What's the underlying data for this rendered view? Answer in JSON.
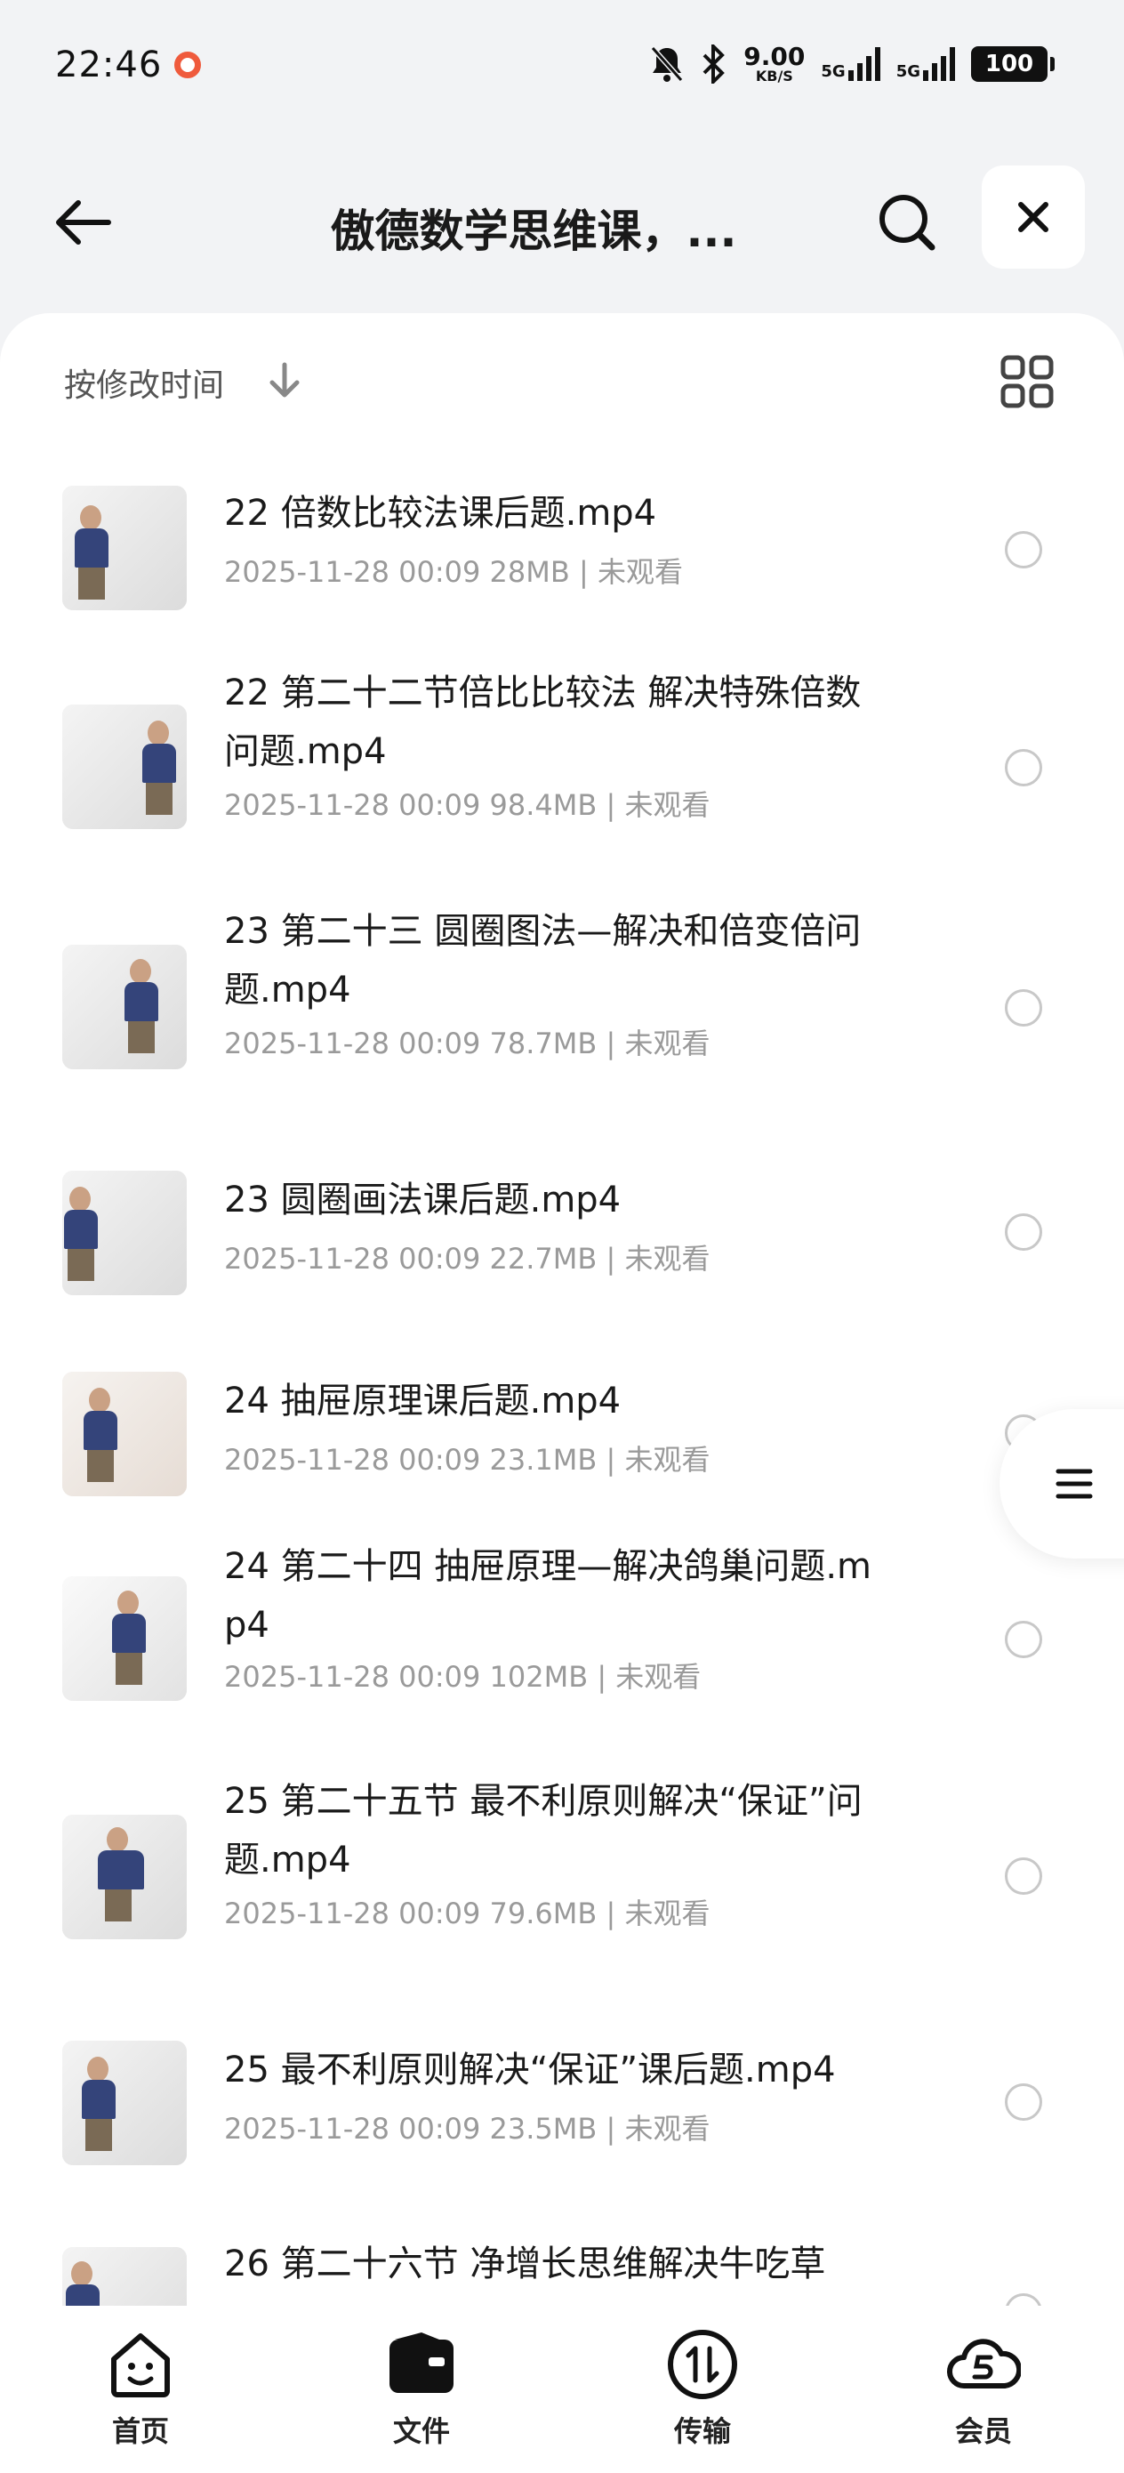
{
  "status_bar": {
    "time": "22:46",
    "net_speed": "9.00",
    "net_unit": "KB/S",
    "signal1_label": "5G",
    "signal2_label": "5G",
    "battery": "100"
  },
  "header": {
    "title": "傲德数学思维课，...",
    "back_icon": "arrow-left-icon",
    "search_icon": "search-icon",
    "close_icon": "close-icon"
  },
  "sort": {
    "label": "按修改时间",
    "direction_icon": "arrow-down-icon",
    "view_icon": "grid-view-icon"
  },
  "files": [
    {
      "name": "22 倍数比较法课后题.mp4",
      "date": "2025-11-28 00:09",
      "size": "28MB",
      "status": "未观看"
    },
    {
      "name": "22 第二十二节倍比比较法 解决特殊倍数问题.mp4",
      "date": "2025-11-28 00:09",
      "size": "98.4MB",
      "status": "未观看"
    },
    {
      "name": "23 第二十三 圆圈图法—解决和倍变倍问题.mp4",
      "date": "2025-11-28 00:09",
      "size": "78.7MB",
      "status": "未观看"
    },
    {
      "name": "23 圆圈画法课后题.mp4",
      "date": "2025-11-28 00:09",
      "size": "22.7MB",
      "status": "未观看"
    },
    {
      "name": "24 抽屉原理课后题.mp4",
      "date": "2025-11-28 00:09",
      "size": "23.1MB",
      "status": "未观看"
    },
    {
      "name": "24 第二十四 抽屉原理—解决鸽巢问题.mp4",
      "date": "2025-11-28 00:09",
      "size": "102MB",
      "status": "未观看"
    },
    {
      "name": "25 第二十五节 最不利原则解决“保证”问题.mp4",
      "date": "2025-11-28 00:09",
      "size": "79.6MB",
      "status": "未观看"
    },
    {
      "name": "25 最不利原则解决“保证”课后题.mp4",
      "date": "2025-11-28 00:09",
      "size": "23.5MB",
      "status": "未观看"
    },
    {
      "name": "26 第二十六节 净增长思维解决牛吃草",
      "date": "",
      "size": "",
      "status": ""
    }
  ],
  "meta_separator": "|",
  "bottom_nav": [
    {
      "label": "首页",
      "icon": "home-face-icon"
    },
    {
      "label": "文件",
      "icon": "folder-wallet-icon"
    },
    {
      "label": "传输",
      "icon": "transfer-icon"
    },
    {
      "label": "会员",
      "icon": "vip-cloud-icon"
    }
  ],
  "colors": {
    "accent_record": "#ef5a3c",
    "background": "#f2f3f5",
    "meta_text": "#9a9a9a"
  }
}
